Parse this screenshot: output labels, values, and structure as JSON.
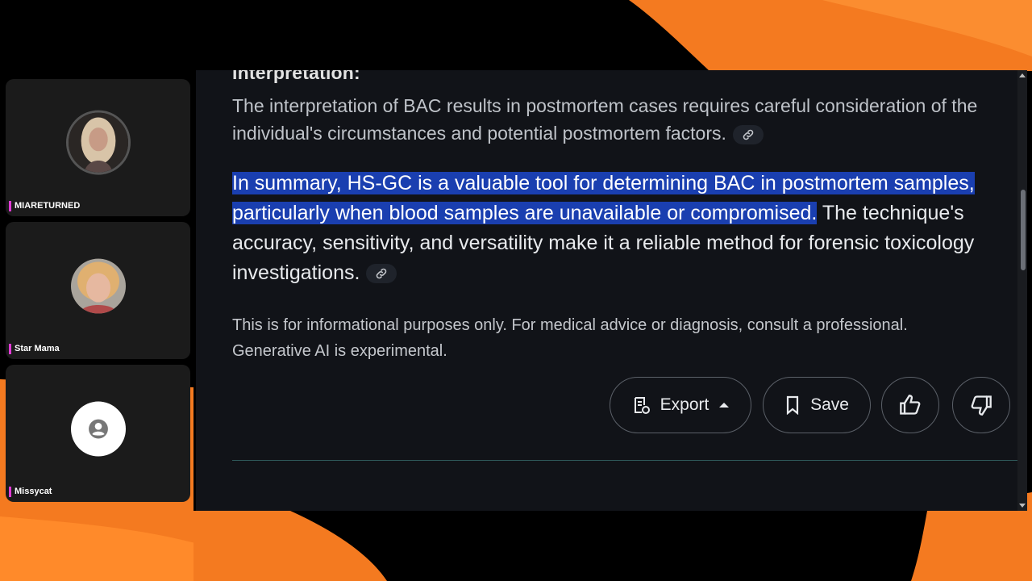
{
  "participants": [
    {
      "name": "MIARETURNED"
    },
    {
      "name": "Star Mama"
    },
    {
      "name": "Missycat"
    }
  ],
  "document": {
    "heading": "Interpretation:",
    "para1": "The interpretation of BAC results in postmortem cases requires careful consideration of the individual's circumstances and potential postmortem factors.",
    "para2_highlighted": "In summary, HS-GC is a valuable tool for determining BAC in postmortem samples, particularly when blood samples are unavailable or compromised.",
    "para2_rest": " The technique's accuracy, sensitivity, and versatility make it a reliable method for forensic toxicology investigations.",
    "disclaimer_line1": "This is for informational purposes only. For medical advice or diagnosis, consult a professional.",
    "disclaimer_line2": "Generative AI is experimental."
  },
  "actions": {
    "export_label": "Export",
    "save_label": "Save"
  },
  "icons": {
    "link": "link-icon",
    "export": "export-icon",
    "save": "bookmark-icon",
    "thumbs_up": "thumbs-up-icon",
    "thumbs_down": "thumbs-down-icon",
    "default_avatar": "person-icon"
  },
  "colors": {
    "accent_orange": "#f47a20",
    "highlight": "#1a3fb0",
    "name_marker": "#e23bd6"
  }
}
